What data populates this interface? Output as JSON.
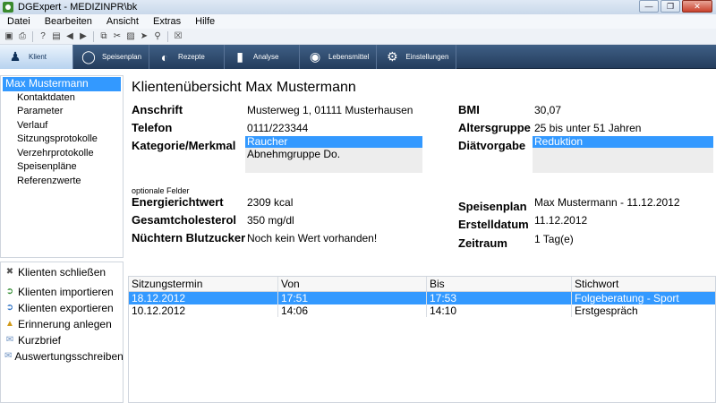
{
  "window": {
    "title": "DGExpert - MEDIZINPR\\bk"
  },
  "menu": [
    "Datei",
    "Bearbeiten",
    "Ansicht",
    "Extras",
    "Hilfe"
  ],
  "modules": [
    "Klient",
    "Speisenplan",
    "Rezepte",
    "Analyse",
    "Lebensmittel",
    "Einstellungen"
  ],
  "nav": {
    "root": "Max Mustermann",
    "items": [
      "Kontaktdaten",
      "Parameter",
      "Verlauf",
      "Sitzungsprotokolle",
      "Verzehrprotokolle",
      "Speisenpläne",
      "Referenzwerte"
    ]
  },
  "actions": [
    "Klienten schließen",
    "Klienten importieren",
    "Klienten exportieren",
    "Erinnerung anlegen",
    "Kurzbrief",
    "Auswertungsschreiben"
  ],
  "overview": {
    "title": "Klientenübersicht  Max Mustermann",
    "address_label": "Anschrift",
    "address": "Musterweg 1, 01111 Musterhausen",
    "phone_label": "Telefon",
    "phone": "0111/223344",
    "category_label": "Kategorie/Merkmal",
    "categories": [
      "Raucher",
      "Abnehmgruppe Do."
    ],
    "bmi_label": "BMI",
    "bmi": "30,07",
    "age_label": "Altersgruppe",
    "age": "25 bis unter 51 Jahren",
    "diet_label": "Diätvorgabe",
    "diet": [
      "Reduktion"
    ],
    "optional_label": "optionale Felder",
    "energy_label": "Energierichtwert",
    "energy": "2309 kcal",
    "chol_label": "Gesamtcholesterol",
    "chol": "350 mg/dl",
    "sugar_label": "Nüchtern Blutzucker",
    "sugar": "Noch kein Wert vorhanden!",
    "plan_label": "Speisenplan",
    "plan": "Max  Mustermann - 11.12.2012",
    "created_label": "Erstelldatum",
    "created": "11.12.2012",
    "period_label": "Zeitraum",
    "period": "1 Tag(e)"
  },
  "sessions": {
    "headers": [
      "Sitzungstermin",
      "Von",
      "Bis",
      "Stichwort"
    ],
    "rows": [
      [
        "18.12.2012",
        "17:51",
        "17:53",
        "Folgeberatung - Sport"
      ],
      [
        "10.12.2012",
        "14:06",
        "14:10",
        "Erstgespräch"
      ]
    ]
  }
}
